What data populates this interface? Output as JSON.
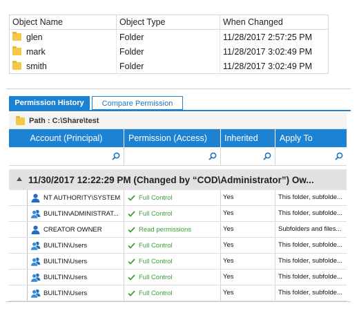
{
  "objects": {
    "columns": [
      "Object Name",
      "Object Type",
      "When Changed"
    ],
    "rows": [
      {
        "name": "glen",
        "type": "Folder",
        "changed": "11/28/2017 2:57:25 PM"
      },
      {
        "name": "mark",
        "type": "Folder",
        "changed": "11/28/2017 3:02:49 PM"
      },
      {
        "name": "smith",
        "type": "Folder",
        "changed": "11/28/2017 3:02:49 PM"
      }
    ]
  },
  "tabs": {
    "history": "Permission History",
    "compare": "Compare Permission",
    "active": "history"
  },
  "grid": {
    "path": "Path : C:\\Share\\test",
    "columns": {
      "account": "Account (Principal)",
      "permission": "Permission (Access)",
      "inherited": "Inherited",
      "apply": "Apply To"
    },
    "group": {
      "label": "11/30/2017 12:22:29 PM (Changed by “COD\\Administrator”)    Ow..."
    },
    "rows": [
      {
        "account": "NT AUTHORITY\\SYSTEM",
        "permission": "Full Control",
        "inherited": "Yes",
        "apply": "This folder, subfolde..."
      },
      {
        "account": "BUILTIN\\ADMINISTRAT...",
        "permission": "Full Control",
        "inherited": "Yes",
        "apply": "This folder, subfolde..."
      },
      {
        "account": "CREATOR OWNER",
        "permission": "Read permissions",
        "inherited": "Yes",
        "apply": "Subfolders and files..."
      },
      {
        "account": "BUILTIN\\Users",
        "permission": "Full Control",
        "inherited": "Yes",
        "apply": "This folder, subfolde..."
      },
      {
        "account": "BUILTIN\\Users",
        "permission": "Full Control",
        "inherited": "Yes",
        "apply": "This folder, subfolde..."
      },
      {
        "account": "BUILTIN\\Users",
        "permission": "Full Control",
        "inherited": "Yes",
        "apply": "This folder, subfolde..."
      },
      {
        "account": "BUILTIN\\Users",
        "permission": "Full Control",
        "inherited": "Yes",
        "apply": "This folder, subfolde..."
      }
    ]
  },
  "icons": {
    "folder": "folder-icon",
    "user": "user-icon",
    "check": "check-icon",
    "search": "search-icon",
    "collapse": "collapse-icon"
  },
  "colors": {
    "accent": "#1e82d2",
    "check": "#3a9e35",
    "folder": "#f4c846",
    "group_bg": "#e2e2e2"
  }
}
